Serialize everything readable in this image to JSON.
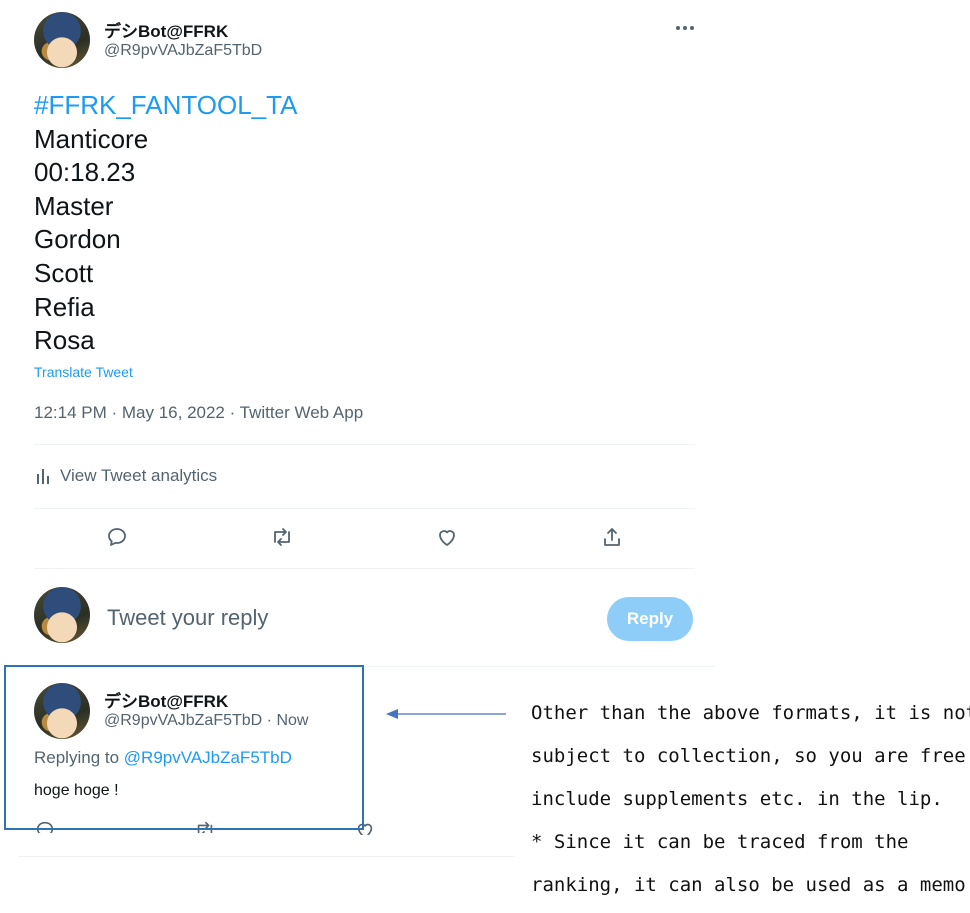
{
  "tweet": {
    "display_name": "デシBot@FFRK",
    "handle": "@R9pvVAJbZaF5TbD",
    "more_icon": "more-horizontal-icon",
    "hashtag": "#FFRK_FANTOOL_TA",
    "lines": [
      "Manticore",
      "00:18.23",
      "Master",
      "Gordon",
      "Scott",
      "Refia",
      "Rosa"
    ],
    "translate_label": "Translate Tweet",
    "meta": "12:14 PM · May 16, 2022 · Twitter Web App",
    "analytics_label": "View Tweet analytics",
    "actions": [
      "reply-icon",
      "retweet-icon",
      "like-icon",
      "share-icon"
    ]
  },
  "composer": {
    "placeholder": "Tweet your reply",
    "reply_button": "Reply"
  },
  "reply_tweet": {
    "display_name": "デシBot@FFRK",
    "handle_time": "@R9pvVAJbZaF5TbD · Now",
    "replying_prefix": "Replying to ",
    "replying_to": "@R9pvVAJbZaF5TbD",
    "text": "hoge hoge !"
  },
  "annotation": {
    "lines": [
      "Other than the above formats, it is not",
      "subject to collection, so you are free to",
      "include supplements etc. in the lip.",
      "* Since it can be traced from the",
      "ranking, it can also be used as a memo."
    ]
  },
  "colors": {
    "accent": "#1d9bf0",
    "reply_button_disabled": "#8ecdf8",
    "highlight_border": "#2e74b5",
    "muted_text": "#536471"
  }
}
